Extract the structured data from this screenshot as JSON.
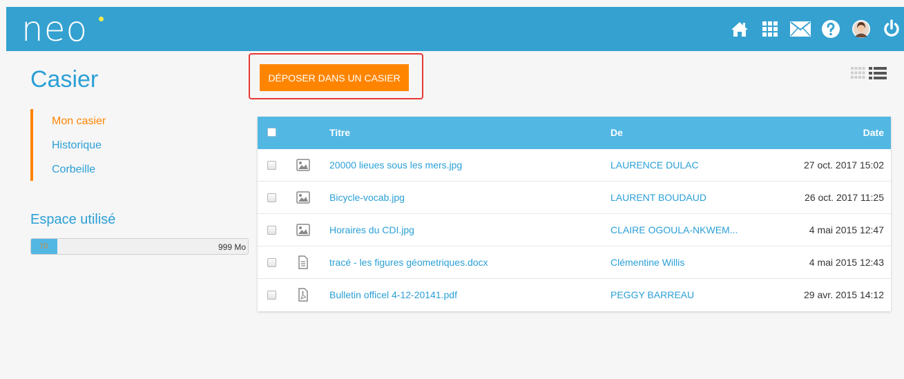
{
  "header": {
    "logo": "neo",
    "nav_icons": [
      "home-icon",
      "apps-icon",
      "mail-icon",
      "help-icon",
      "avatar",
      "power-icon"
    ]
  },
  "page": {
    "title": "Casier"
  },
  "sidebar": {
    "items": [
      {
        "label": "Mon casier",
        "active": true
      },
      {
        "label": "Historique",
        "active": false
      },
      {
        "label": "Corbeille",
        "active": false
      }
    ]
  },
  "storage": {
    "title": "Espace utilisé",
    "used_label": "70",
    "used_fraction": 0.12,
    "max_label": "999 Mo"
  },
  "toolbar": {
    "deposit_label": "DÉPOSER DANS UN CASIER"
  },
  "table": {
    "headers": {
      "title": "Titre",
      "from": "De",
      "date": "Date"
    },
    "rows": [
      {
        "icon": "image-file-icon",
        "title": "20000 lieues sous les mers.jpg",
        "from": "LAURENCE DULAC",
        "date": "27 oct. 2017 15:02"
      },
      {
        "icon": "image-file-icon",
        "title": "Bicycle-vocab.jpg",
        "from": "LAURENT BOUDAUD",
        "date": "26 oct. 2017 11:25"
      },
      {
        "icon": "image-file-icon",
        "title": "Horaires du CDI.jpg",
        "from": "CLAIRE OGOULA-NKWEM...",
        "date": "4 mai 2015 12:47"
      },
      {
        "icon": "document-file-icon",
        "title": "tracé - les figures géometriques.docx",
        "from": "Clémentine Willis",
        "date": "4 mai 2015 12:43"
      },
      {
        "icon": "pdf-file-icon",
        "title": "Bulletin officel 4-12-20141.pdf",
        "from": "PEGGY BARREAU",
        "date": "29 avr. 2015 14:12"
      }
    ]
  },
  "colors": {
    "header_bg": "#35a1d0",
    "accent": "#ff8500",
    "link": "#2a9fd6",
    "table_header": "#53b7e3",
    "highlight_frame": "#e53935"
  }
}
